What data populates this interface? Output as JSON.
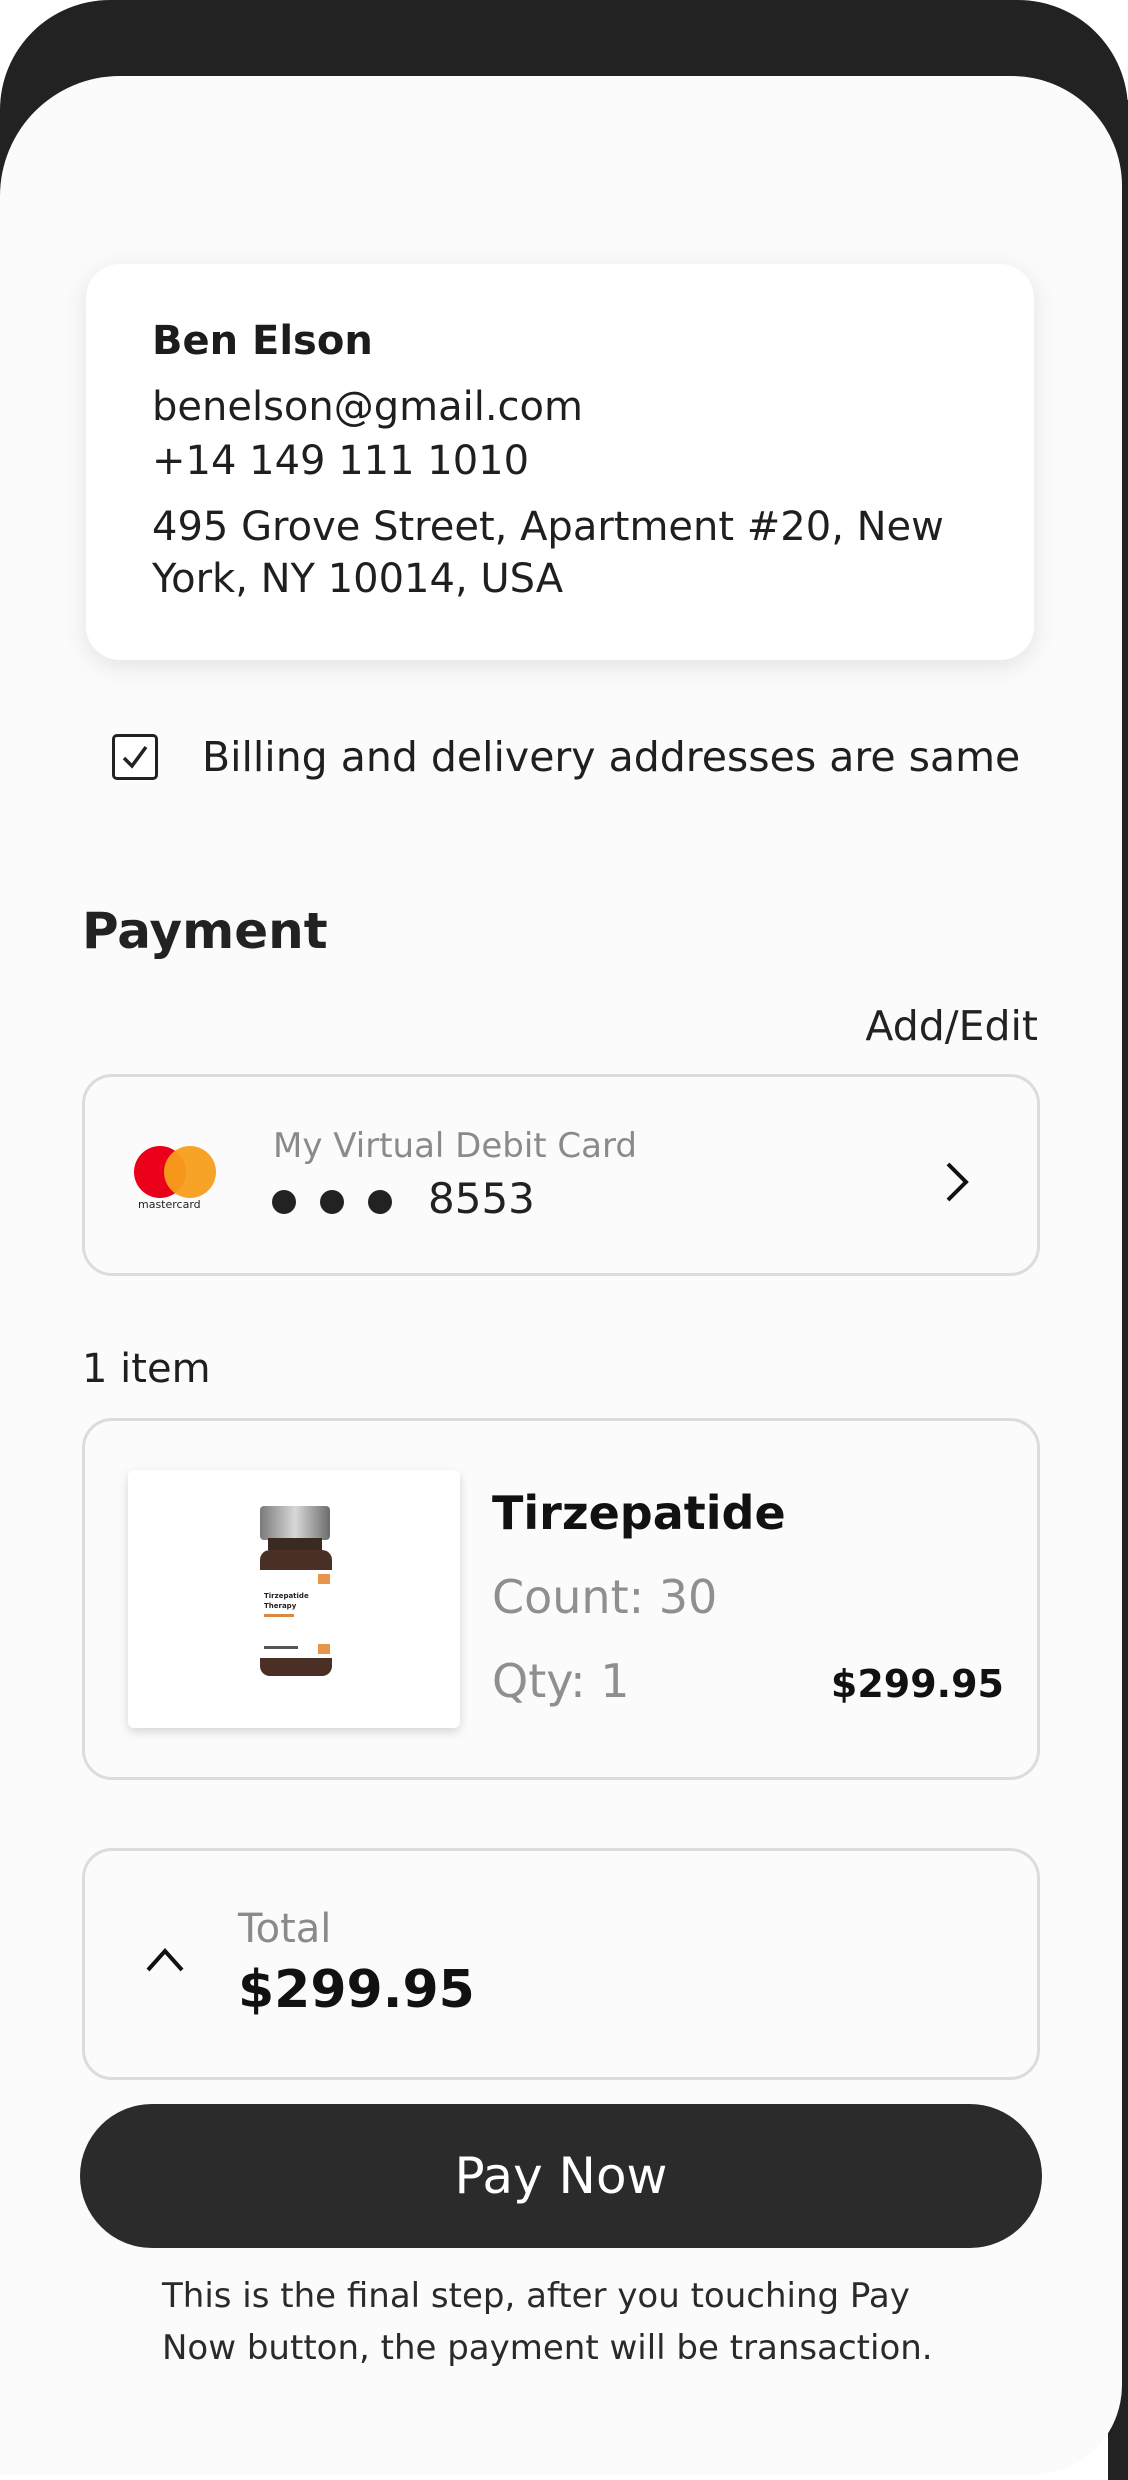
{
  "address": {
    "name": "Ben Elson",
    "email": "benelson@gmail.com",
    "phone": "+14 149 111 1010",
    "address_line1": "495 Grove Street, Apartment #20, New",
    "address_line2": "York, NY 10014, USA"
  },
  "billing": {
    "checked": true,
    "label": "Billing and delivery addresses are same"
  },
  "payment": {
    "title": "Payment",
    "add_edit": "Add/Edit",
    "card_brand": "mastercard",
    "card_name": "My Virtual Debit Card",
    "card_last4": "8553",
    "brand_colors": {
      "red": "#eb001b",
      "orange": "#f79e1b"
    }
  },
  "items": {
    "count_label": "1 item",
    "list": [
      {
        "name": "Tirzepatide",
        "count": "Count: 30",
        "qty": "Qty: 1",
        "price": "$299.95",
        "vial_label_line1": "Tirzepatide",
        "vial_label_line2": "Therapy"
      }
    ]
  },
  "total": {
    "label": "Total",
    "value": "$299.95"
  },
  "pay_button": "Pay Now",
  "note_line1": "This is the final step, after you touching Pay",
  "note_line2": "Now button, the payment will be transaction.",
  "colors": {
    "button_bg": "#2b2b2b",
    "muted_text": "#8a8a8a",
    "border": "#dcdcdc"
  }
}
